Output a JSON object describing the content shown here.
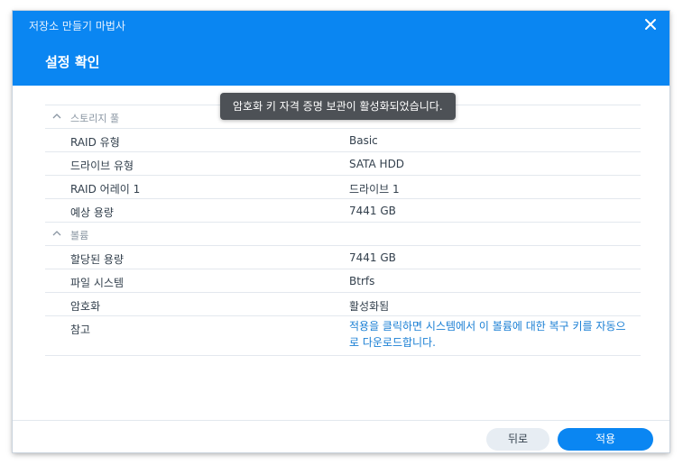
{
  "wizard": {
    "title": "저장소 만들기 마법사",
    "step_title": "설정 확인"
  },
  "toast": {
    "message": "암호화 키 자격 증명 보관이 활성화되었습니다."
  },
  "sections": {
    "storage_pool": {
      "label": "스토리지 풀",
      "rows": [
        {
          "label": "RAID 유형",
          "value": "Basic"
        },
        {
          "label": "드라이브 유형",
          "value": "SATA HDD"
        },
        {
          "label": "RAID 어레이 1",
          "value": "드라이브 1"
        },
        {
          "label": "예상 용량",
          "value": "7441 GB"
        }
      ]
    },
    "volume": {
      "label": "볼륨",
      "rows": [
        {
          "label": "할당된 용량",
          "value": "7441 GB"
        },
        {
          "label": "파일 시스템",
          "value": "Btrfs"
        },
        {
          "label": "암호화",
          "value": "활성화됨"
        },
        {
          "label": "참고",
          "value": "적용을 클릭하면 시스템에서 이 볼륨에 대한 복구 키를 자동으로 다운로드합니다."
        }
      ]
    }
  },
  "footer": {
    "back_label": "뒤로",
    "apply_label": "적용"
  },
  "colors": {
    "accent": "#0a86f2",
    "link": "#1a7fd4",
    "toast_bg": "#4d5156"
  },
  "icons": {
    "close": "close-icon",
    "section_toggle": "chevron-up-icon"
  }
}
